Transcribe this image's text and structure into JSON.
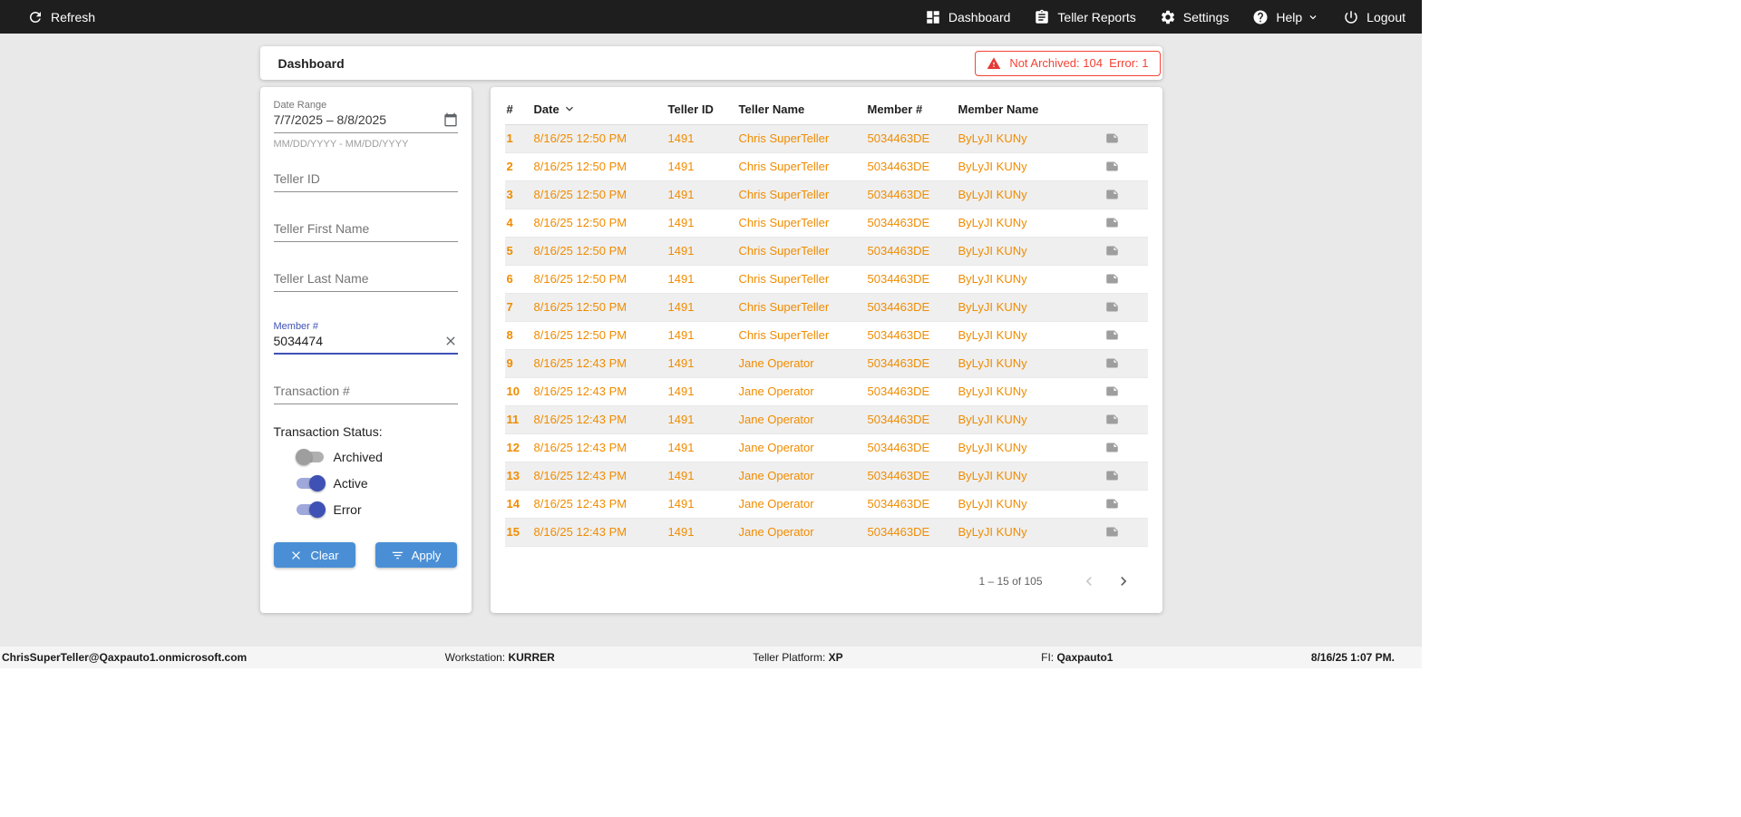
{
  "topbar": {
    "refresh": "Refresh",
    "dashboard": "Dashboard",
    "teller_reports": "Teller Reports",
    "settings": "Settings",
    "help": "Help",
    "logout": "Logout"
  },
  "header": {
    "title": "Dashboard",
    "alert_text": "Not Archived: 104  Error: 1"
  },
  "filters": {
    "date_range": {
      "label": "Date Range",
      "value": "7/7/2025 – 8/8/2025",
      "helper": "MM/DD/YYYY - MM/DD/YYYY"
    },
    "teller_id_placeholder": "Teller ID",
    "teller_first_name_placeholder": "Teller First Name",
    "teller_last_name_placeholder": "Teller Last Name",
    "member": {
      "label": "Member #",
      "value": "5034474"
    },
    "transaction_placeholder": "Transaction #",
    "status_label": "Transaction Status:",
    "toggles": [
      {
        "label": "Archived",
        "on": false
      },
      {
        "label": "Active",
        "on": true
      },
      {
        "label": "Error",
        "on": true
      }
    ],
    "clear_button": "Clear",
    "apply_button": "Apply"
  },
  "table": {
    "headers": [
      "#",
      "Date",
      "Teller ID",
      "Teller Name",
      "Member #",
      "Member Name"
    ],
    "sort_column": "Date",
    "sort_direction": "desc",
    "rows": [
      {
        "num": "1",
        "date": "8/16/25 12:50 PM",
        "teller_id": "1491",
        "teller_name": "Chris SuperTeller",
        "member_num": "5034463DE",
        "member_name": "ByLyJI KUNy"
      },
      {
        "num": "2",
        "date": "8/16/25 12:50 PM",
        "teller_id": "1491",
        "teller_name": "Chris SuperTeller",
        "member_num": "5034463DE",
        "member_name": "ByLyJI KUNy"
      },
      {
        "num": "3",
        "date": "8/16/25 12:50 PM",
        "teller_id": "1491",
        "teller_name": "Chris SuperTeller",
        "member_num": "5034463DE",
        "member_name": "ByLyJI KUNy"
      },
      {
        "num": "4",
        "date": "8/16/25 12:50 PM",
        "teller_id": "1491",
        "teller_name": "Chris SuperTeller",
        "member_num": "5034463DE",
        "member_name": "ByLyJI KUNy"
      },
      {
        "num": "5",
        "date": "8/16/25 12:50 PM",
        "teller_id": "1491",
        "teller_name": "Chris SuperTeller",
        "member_num": "5034463DE",
        "member_name": "ByLyJI KUNy"
      },
      {
        "num": "6",
        "date": "8/16/25 12:50 PM",
        "teller_id": "1491",
        "teller_name": "Chris SuperTeller",
        "member_num": "5034463DE",
        "member_name": "ByLyJI KUNy"
      },
      {
        "num": "7",
        "date": "8/16/25 12:50 PM",
        "teller_id": "1491",
        "teller_name": "Chris SuperTeller",
        "member_num": "5034463DE",
        "member_name": "ByLyJI KUNy"
      },
      {
        "num": "8",
        "date": "8/16/25 12:50 PM",
        "teller_id": "1491",
        "teller_name": "Chris SuperTeller",
        "member_num": "5034463DE",
        "member_name": "ByLyJI KUNy"
      },
      {
        "num": "9",
        "date": "8/16/25 12:43 PM",
        "teller_id": "1491",
        "teller_name": "Jane Operator",
        "member_num": "5034463DE",
        "member_name": "ByLyJI KUNy"
      },
      {
        "num": "10",
        "date": "8/16/25 12:43 PM",
        "teller_id": "1491",
        "teller_name": "Jane Operator",
        "member_num": "5034463DE",
        "member_name": "ByLyJI KUNy"
      },
      {
        "num": "11",
        "date": "8/16/25 12:43 PM",
        "teller_id": "1491",
        "teller_name": "Jane Operator",
        "member_num": "5034463DE",
        "member_name": "ByLyJI KUNy"
      },
      {
        "num": "12",
        "date": "8/16/25 12:43 PM",
        "teller_id": "1491",
        "teller_name": "Jane Operator",
        "member_num": "5034463DE",
        "member_name": "ByLyJI KUNy"
      },
      {
        "num": "13",
        "date": "8/16/25 12:43 PM",
        "teller_id": "1491",
        "teller_name": "Jane Operator",
        "member_num": "5034463DE",
        "member_name": "ByLyJI KUNy"
      },
      {
        "num": "14",
        "date": "8/16/25 12:43 PM",
        "teller_id": "1491",
        "teller_name": "Jane Operator",
        "member_num": "5034463DE",
        "member_name": "ByLyJI KUNy"
      },
      {
        "num": "15",
        "date": "8/16/25 12:43 PM",
        "teller_id": "1491",
        "teller_name": "Jane Operator",
        "member_num": "5034463DE",
        "member_name": "ByLyJI KUNy"
      }
    ],
    "pagination": {
      "range_label": "1 – 15 of 105"
    }
  },
  "footer": {
    "user": "ChrisSuperTeller@Qaxpauto1.onmicrosoft.com",
    "workstation_label": "Workstation:",
    "workstation_value": "KURRER",
    "platform_label": "Teller Platform:",
    "platform_value": "XP",
    "fi_label": "FI:",
    "fi_value": "Qaxpauto1",
    "timestamp": "8/16/25 1:07 PM."
  },
  "colors": {
    "topbar_bg": "#1e1e1e",
    "accent_button_blue": "#4a8fd6",
    "focus_indigo": "#3f51b5",
    "table_text_orange": "#f08c00",
    "alert_red": "#f44336"
  }
}
